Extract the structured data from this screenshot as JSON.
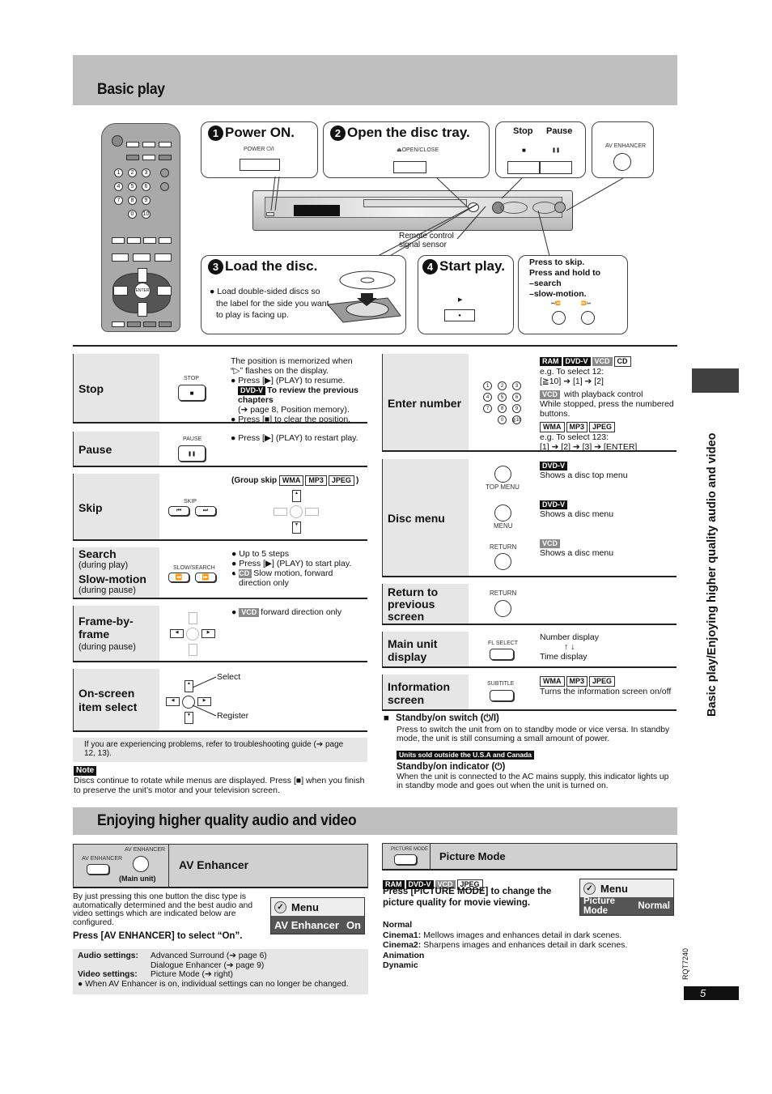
{
  "header": {
    "title": "Basic play"
  },
  "steps": {
    "s1": {
      "num": "1",
      "title": "Power ON.",
      "button_label": "POWER ⏻/I"
    },
    "s2": {
      "num": "2",
      "title": "Open the disc tray.",
      "button_label": "⏏OPEN/CLOSE"
    },
    "stop_pause": {
      "stop": "Stop",
      "pause": "Pause",
      "stop_icon": "■",
      "pause_icon": "❚❚"
    },
    "av": {
      "label": "AV ENHANCER"
    },
    "sensor_label": "Remote control signal sensor",
    "s3": {
      "num": "3",
      "title": "Load the disc.",
      "note": "Load double-sided discs so the label for the side you want to play is facing up."
    },
    "s4": {
      "num": "4",
      "title": "Start play.",
      "play_icon": "▶"
    },
    "skip_note": {
      "l1": "Press to skip.",
      "l2": "Press and hold to",
      "l3": "–search",
      "l4": "–slow-motion."
    }
  },
  "left_table": [
    {
      "label": "Stop",
      "btn": "STOP",
      "icon": "■",
      "desc": [
        "The position is memorized when “▷” flashes on the display.",
        "● Press [▶] (PLAY) to resume.",
        "To review the previous chapters",
        "(➔ page 8, Position memory).",
        "● Press [■] to clear the position."
      ],
      "tag": "DVD-V"
    },
    {
      "label": "Pause",
      "btn": "PAUSE",
      "icon": "❚❚",
      "desc": [
        "● Press [▶] (PLAY) to restart play."
      ]
    },
    {
      "label": "Skip",
      "btn": "SKIP",
      "icons": [
        "⏮",
        "⏭"
      ],
      "group_skip": "(Group skip",
      "tags": [
        "WMA",
        "MP3",
        "JPEG"
      ]
    },
    {
      "label": "Search",
      "sub1": "(during play)",
      "label2": "Slow-motion",
      "sub2": "(during pause)",
      "btn": "SLOW/SEARCH",
      "icons": [
        "⏪",
        "⏩"
      ],
      "desc": [
        "● Up to 5 steps",
        "● Press [▶] (PLAY) to start play.",
        "Slow motion, forward direction only"
      ],
      "tag": "VCD"
    },
    {
      "label": "Frame-by-frame",
      "sub": "(during pause)",
      "desc": "forward direction only",
      "tag": "VCD"
    },
    {
      "label": "On-screen item select",
      "select": "Select",
      "register": "Register"
    }
  ],
  "trouble": "If you are experiencing problems, refer to troubleshooting guide (➔ page 12, 13).",
  "note": {
    "title": "Note",
    "text": "Discs continue to rotate while menus are displayed. Press [■] when you finish to preserve the unit’s motor and your television screen."
  },
  "right_table": [
    {
      "label": "Enter number",
      "keys": [
        "1",
        "2",
        "3",
        "4",
        "5",
        "6",
        "7",
        "8",
        "9",
        "0",
        "≧10"
      ],
      "tags1": [
        "RAM",
        "DVD-V",
        "VCD",
        "CD"
      ],
      "d1": "e.g. To select 12:",
      "d2": "[≧10] ➔ [1] ➔ [2]",
      "tag2": "VCD",
      "d3": "with playback control",
      "d4": "While stopped, press the numbered buttons.",
      "tags3": [
        "WMA",
        "MP3",
        "JPEG"
      ],
      "d5": "e.g. To select 123:",
      "d6": "[1] ➔ [2] ➔ [3] ➔ [ENTER]"
    },
    {
      "label": "Disc menu",
      "items": [
        {
          "btn": "TOP MENU",
          "tag": "DVD-V",
          "desc": "Shows a disc top menu"
        },
        {
          "btn": "MENU",
          "tag": "DVD-V",
          "desc": "Shows a disc menu"
        },
        {
          "btn": "RETURN",
          "tag": "VCD",
          "desc": "Shows a disc menu"
        }
      ]
    },
    {
      "label": "Return to previous screen",
      "btn": "RETURN"
    },
    {
      "label": "Main unit display",
      "btn": "FL SELECT",
      "d1": "Number display",
      "arrows": "↑ ↓",
      "d2": "Time display"
    },
    {
      "label": "Information screen",
      "btn": "SUBTITLE",
      "tags": [
        "WMA",
        "MP3",
        "JPEG"
      ],
      "desc": "Turns the information screen on/off"
    }
  ],
  "standby": {
    "switch_title": "Standby/on switch (⏻/I)",
    "switch_text": "Press to switch the unit from on to standby mode or vice versa. In standby mode, the unit is still consuming a small amount of power.",
    "region_badge": "Units sold outside the U.S.A and Canada",
    "indicator_title": "Standby/on indicator (⏻)",
    "indicator_text": "When the unit is connected to the AC mains supply, this indicator lights up in standby mode and goes out when the unit is turned on."
  },
  "section2": {
    "title": "Enjoying higher quality audio and video"
  },
  "av_enhancer": {
    "remote_btn": "AV ENHANCER",
    "unit_btn": "AV ENHANCER",
    "unit_caption": "(Main unit)",
    "title": "AV Enhancer",
    "text": "By just pressing this one button the disc type is automatically determined and the best audio and video settings which are indicated below are configured.",
    "instruction": "Press [AV ENHANCER] to select “On”.",
    "menu": {
      "title": "Menu",
      "item": "AV Enhancer",
      "value": "On"
    },
    "audio_label": "Audio settings:",
    "audio1": "Advanced Surround (➔ page 6)",
    "audio2": "Dialogue Enhancer (➔ page 9)",
    "video_label": "Video settings:",
    "video1": "Picture Mode (➔ right)",
    "bullet": "● When AV Enhancer is on, individual settings can no longer be changed."
  },
  "picture_mode": {
    "btn": "PICTURE MODE",
    "title": "Picture Mode",
    "tags": [
      "RAM",
      "DVD-V",
      "VCD",
      "JPEG"
    ],
    "instruction": "Press [PICTURE MODE] to change the picture quality for movie viewing.",
    "menu": {
      "title": "Menu",
      "item": "Picture Mode",
      "value": "Normal"
    },
    "modes": [
      {
        "name": "Normal",
        "desc": ""
      },
      {
        "name": "Cinema1:",
        "desc": "Mellows images and enhances detail in dark scenes."
      },
      {
        "name": "Cinema2:",
        "desc": "Sharpens images and enhances detail in dark scenes."
      },
      {
        "name": "Animation",
        "desc": ""
      },
      {
        "name": "Dynamic",
        "desc": ""
      }
    ]
  },
  "side_tab": "Basic play/Enjoying higher quality audio and video",
  "doc_code": "RQT7240",
  "page_number": "5"
}
